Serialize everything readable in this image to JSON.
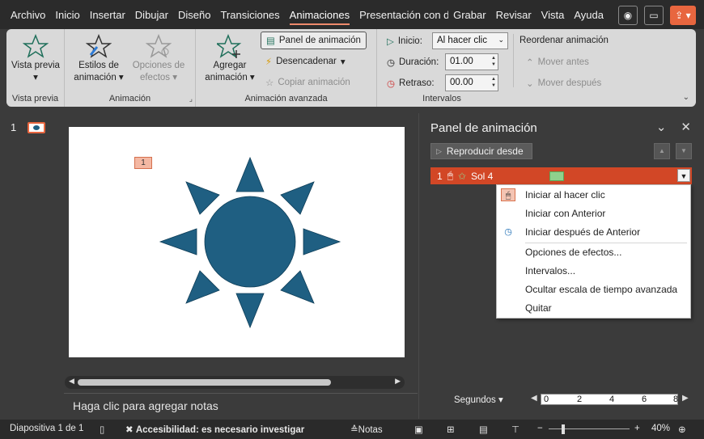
{
  "tabs": [
    "Archivo",
    "Inicio",
    "Insertar",
    "Dibujar",
    "Diseño",
    "Transiciones",
    "Animaciones",
    "Presentación con d",
    "Grabar",
    "Revisar",
    "Vista",
    "Ayuda"
  ],
  "active_tab": "Animaciones",
  "ribbon": {
    "preview": {
      "label": "Vista previa",
      "group": "Vista previa"
    },
    "animation": {
      "styles": "Estilos de animación",
      "effects": "Opciones de efectos",
      "group": "Animación"
    },
    "advanced": {
      "add": "Agregar animación",
      "pane": "Panel de animación",
      "trigger": "Desencadenar",
      "copy": "Copiar animación",
      "group": "Animación avanzada"
    },
    "timing": {
      "start_label": "Inicio:",
      "start_value": "Al hacer clic",
      "duration_label": "Duración:",
      "duration_value": "01.00",
      "delay_label": "Retraso:",
      "delay_value": "00.00",
      "reorder": "Reordenar animación",
      "move_earlier": "Mover antes",
      "move_later": "Mover después",
      "group": "Intervalos"
    }
  },
  "slide_panel": {
    "slide_number": "1"
  },
  "slide": {
    "anim_tag": "1",
    "notes_placeholder": "Haga clic para agregar notas"
  },
  "animation_pane": {
    "title": "Panel de animación",
    "play": "Reproducir desde",
    "item": {
      "number": "1",
      "name": "Sol 4"
    }
  },
  "context_menu": {
    "items": [
      "Iniciar al hacer clic",
      "Iniciar con Anterior",
      "Iniciar después de Anterior",
      "Opciones de efectos...",
      "Intervalos...",
      "Ocultar escala de tiempo avanzada",
      "Quitar"
    ]
  },
  "timeline": {
    "label": "Segundos",
    "ticks": [
      "0",
      "2",
      "4",
      "6",
      "8"
    ]
  },
  "status": {
    "slide": "Diapositiva 1 de 1",
    "accessibility": "Accesibilidad: es necesario investigar",
    "notes": "Notas",
    "zoom": "40%"
  },
  "colors": {
    "accent": "#d24726",
    "sun": "#1f5f82",
    "ribbon": "#d9d9d9"
  }
}
